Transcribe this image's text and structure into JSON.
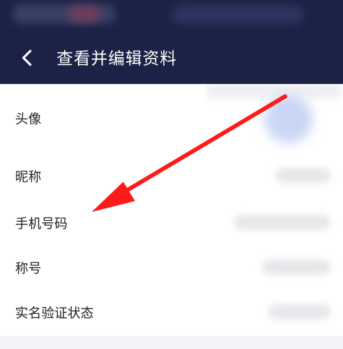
{
  "header": {
    "back_icon": "chevron-left-icon",
    "title": "查看并编辑资料",
    "background": "#1c2246",
    "text_color": "#ffffff"
  },
  "profile": {
    "rows": [
      {
        "label": "头像"
      },
      {
        "label": "昵称"
      },
      {
        "label": "手机号码"
      },
      {
        "label": "称号"
      },
      {
        "label": "实名验证状态"
      }
    ]
  },
  "annotation": {
    "color": "#ff1a1a",
    "shape": "arrow"
  }
}
